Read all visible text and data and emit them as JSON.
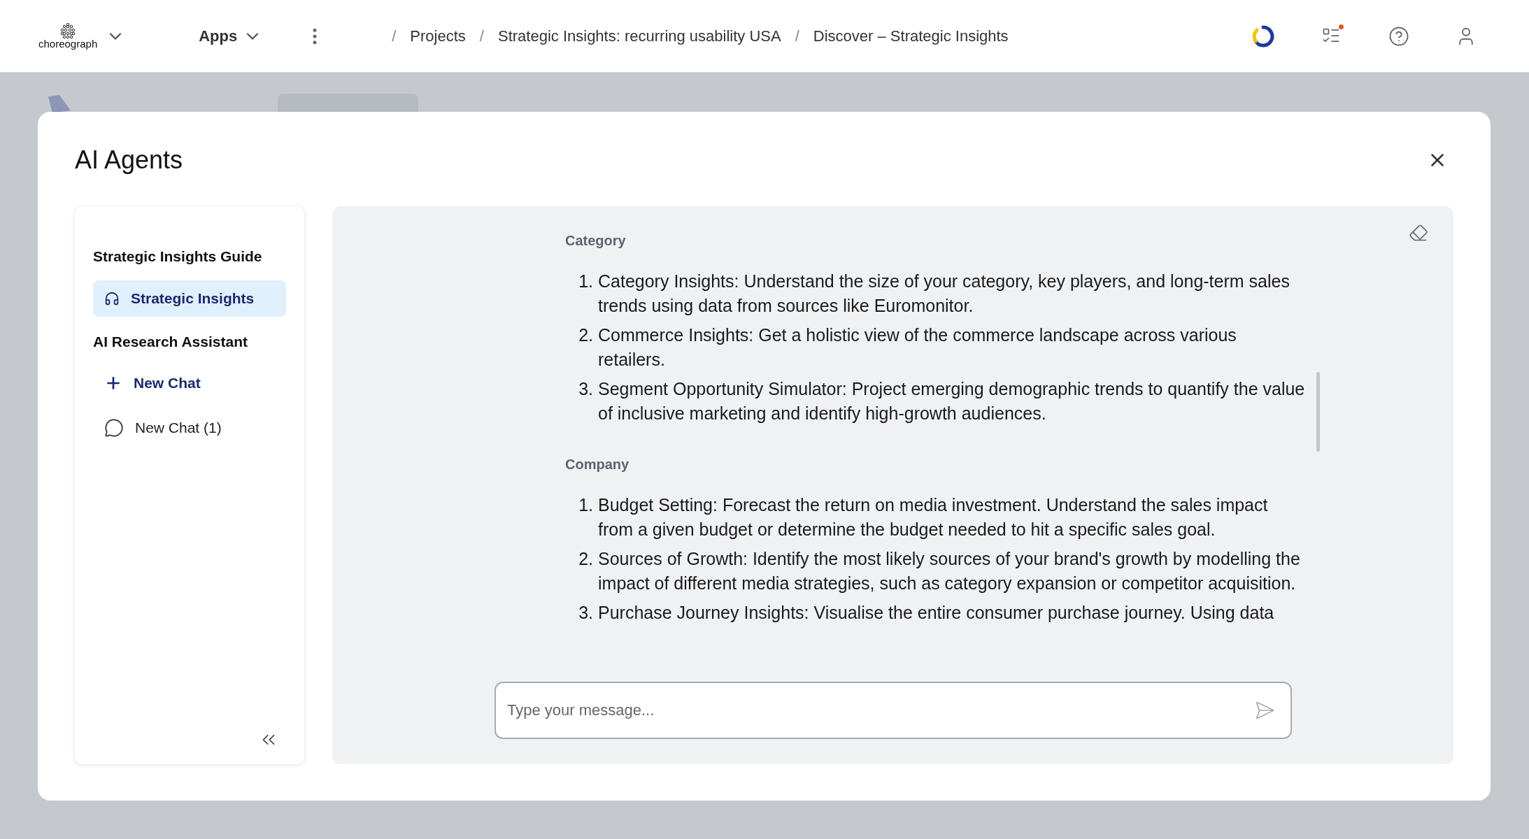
{
  "top_bar": {
    "logo": "choreograph",
    "apps_menu": "Apps",
    "breadcrumb": [
      "Projects",
      "Strategic Insights: recurring usability USA",
      "Discover – Strategic Insights"
    ],
    "separator": "/"
  },
  "modal": {
    "title": "AI Agents",
    "sidebar": {
      "sections": [
        {
          "heading": "Strategic Insights Guide",
          "items": [
            {
              "kind": "agent",
              "label": "Strategic Insights",
              "selected": true
            }
          ]
        },
        {
          "heading": "AI Research Assistant",
          "items": [
            {
              "kind": "new",
              "label": "New Chat",
              "selected": false
            },
            {
              "kind": "chat",
              "label": "New Chat (1)",
              "selected": false
            }
          ]
        }
      ]
    },
    "chat": {
      "sections": [
        {
          "heading": "Category",
          "items": [
            {
              "number": "1.",
              "text": "Category Insights: Understand the size of your category, key players, and long-term sales trends using data from sources like Euromonitor."
            },
            {
              "number": "2.",
              "text": "Commerce Insights: Get a holistic view of the commerce landscape across various retailers."
            },
            {
              "number": "3.",
              "text": "Segment Opportunity Simulator: Project emerging demographic trends to quantify the value of inclusive marketing and identify high-growth audiences."
            }
          ]
        },
        {
          "heading": "Company",
          "items": [
            {
              "number": "1.",
              "text": "Budget Setting: Forecast the return on media investment. Understand the sales impact from a given budget or determine the budget needed to hit a specific sales goal."
            },
            {
              "number": "2.",
              "text": "Sources of Growth: Identify the most likely sources of your brand's growth by modelling the impact of different media strategies, such as category expansion or competitor acquisition."
            },
            {
              "number": "3.",
              "text": "Purchase Journey Insights: Visualise the entire consumer purchase journey. Using data"
            }
          ]
        }
      ],
      "input": {
        "placeholder": "Type your message..."
      }
    }
  }
}
